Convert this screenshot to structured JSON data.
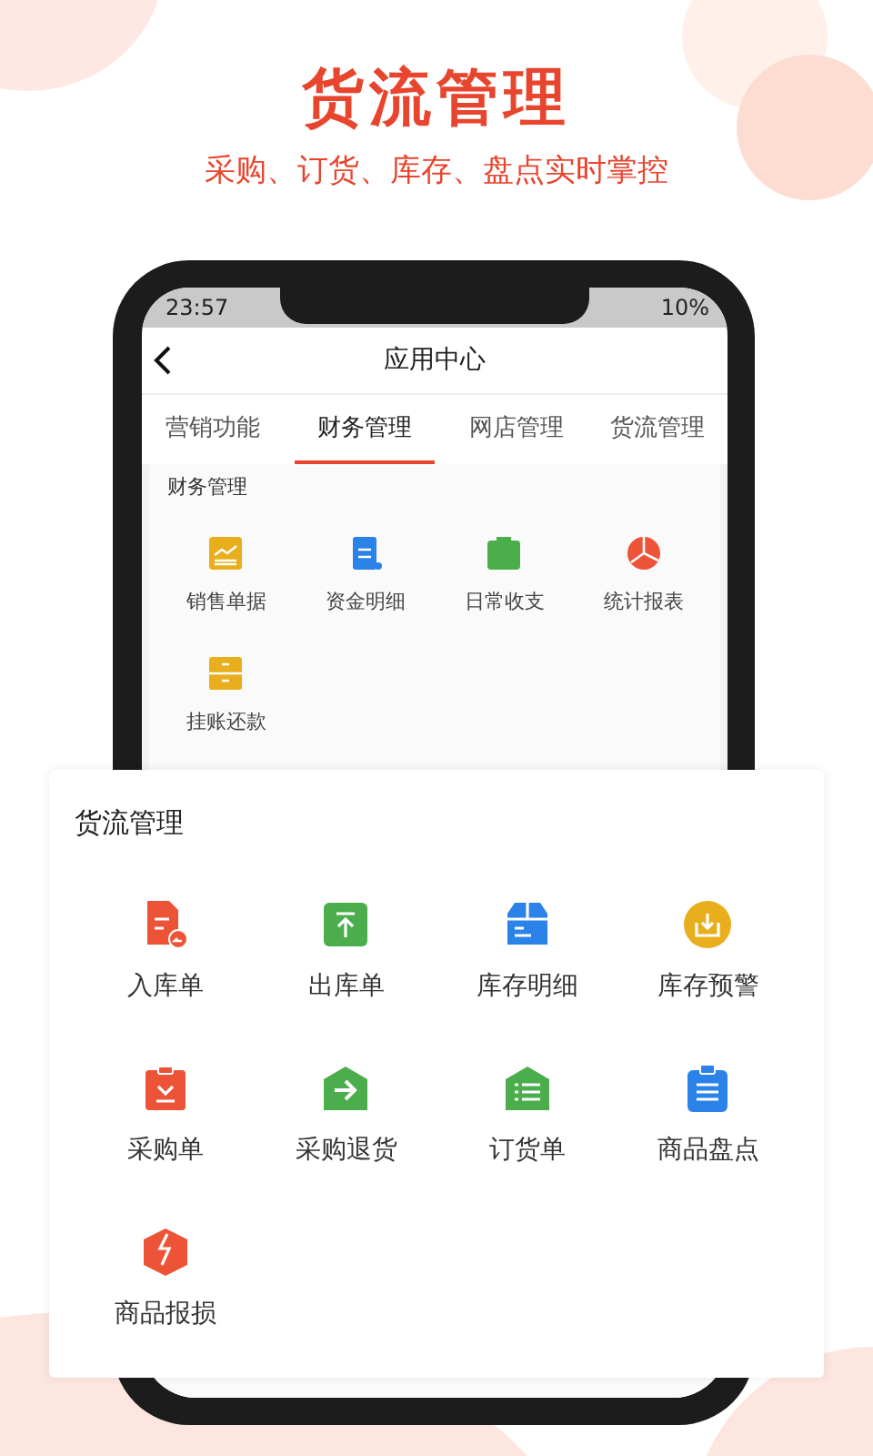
{
  "banner": {
    "title": "货流管理",
    "subtitle": "采购、订货、库存、盘点实时掌控"
  },
  "status_bar": {
    "time": "23:57",
    "battery": "10%"
  },
  "header": {
    "title": "应用中心"
  },
  "tabs": [
    {
      "label": "营销功能",
      "selected": false
    },
    {
      "label": "财务管理",
      "selected": true
    },
    {
      "label": "网店管理",
      "selected": false
    },
    {
      "label": "货流管理",
      "selected": false
    }
  ],
  "finance_section": {
    "title": "财务管理",
    "items": [
      {
        "label": "销售单据"
      },
      {
        "label": "资金明细"
      },
      {
        "label": "日常收支"
      },
      {
        "label": "统计报表"
      },
      {
        "label": "挂账还款"
      }
    ]
  },
  "inventory_card": {
    "title": "货流管理",
    "items": [
      {
        "label": "入库单"
      },
      {
        "label": "出库单"
      },
      {
        "label": "库存明细"
      },
      {
        "label": "库存预警"
      },
      {
        "label": "采购单"
      },
      {
        "label": "采购退货"
      },
      {
        "label": "订货单"
      },
      {
        "label": "商品盘点"
      },
      {
        "label": "商品报损"
      }
    ]
  }
}
